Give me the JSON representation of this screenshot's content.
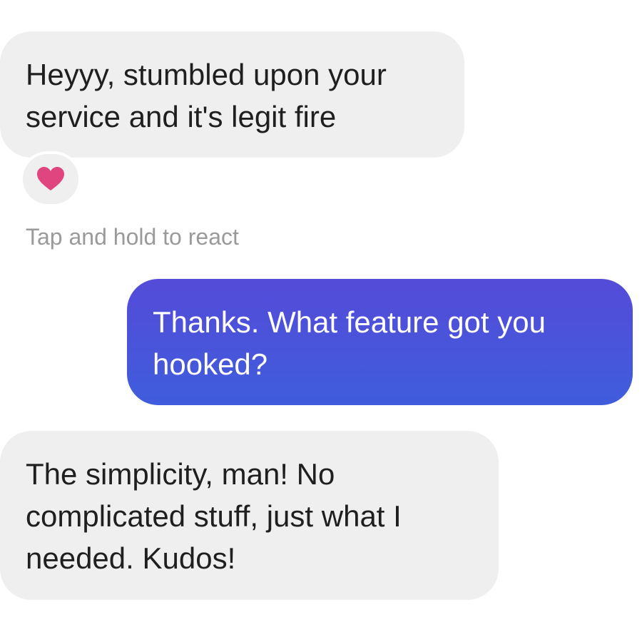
{
  "messages": [
    {
      "direction": "incoming",
      "text": "Heyyy, stumbled upon your service and it's legit fire"
    },
    {
      "direction": "outgoing",
      "text": "Thanks. What feature got you hooked?"
    },
    {
      "direction": "incoming",
      "text": "The simplicity, man! No complicated stuff, just what I needed. Kudos!"
    }
  ],
  "reaction": {
    "icon": "heart-icon",
    "color": "#e0457f"
  },
  "hint_text": "Tap and hold to react",
  "colors": {
    "incoming_bubble": "#efefef",
    "outgoing_bubble_top": "#544bd9",
    "outgoing_bubble_bottom": "#3f5ddc",
    "hint": "#9a9a9a"
  }
}
